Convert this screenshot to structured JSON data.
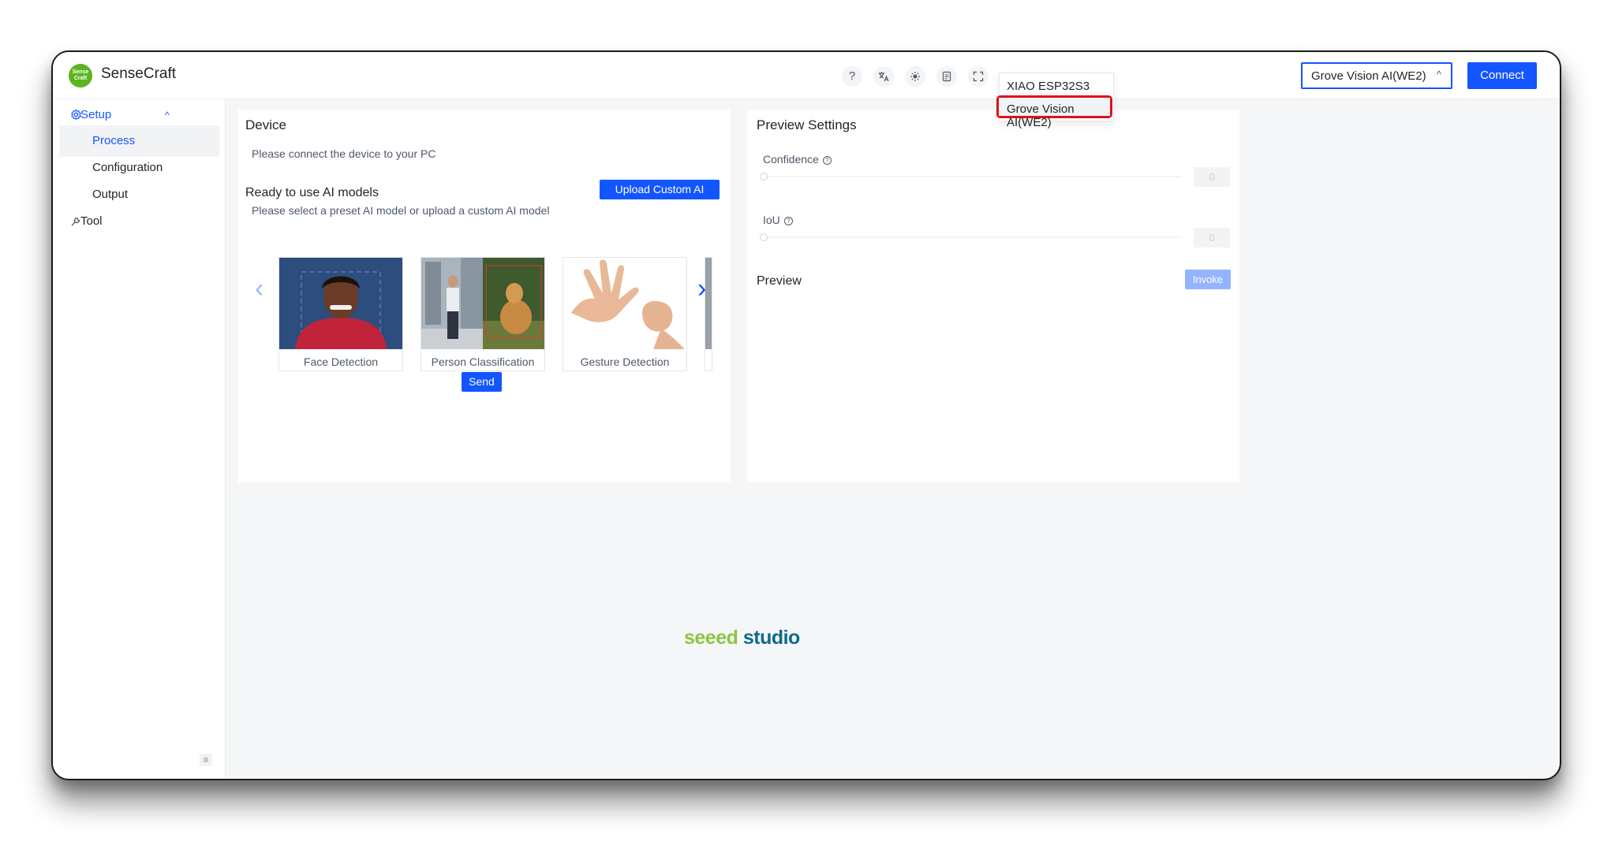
{
  "app": {
    "logo_text": "Sense Craft",
    "title": "SenseCraft"
  },
  "header": {
    "icons": [
      "help-icon",
      "translate-icon",
      "theme-icon",
      "document-icon",
      "fullscreen-icon"
    ],
    "device_select": "Grove Vision AI(WE2)",
    "connect_label": "Connect"
  },
  "dropdown": {
    "options": [
      "XIAO ESP32S3",
      "Grove Vision AI(WE2)"
    ],
    "selected": "Grove Vision AI(WE2)"
  },
  "sidebar": {
    "setup_label": "Setup",
    "items": [
      "Process",
      "Configuration",
      "Output"
    ],
    "active_item": "Process",
    "tool_label": "Tool"
  },
  "device": {
    "title": "Device",
    "message": "Please connect the device to your PC",
    "models_title": "Ready to use AI models",
    "upload_label": "Upload Custom AI Model",
    "models_hint": "Please select a preset AI model or upload a custom AI model",
    "models": [
      "Face Detection",
      "Person Classification",
      "Gesture Detection"
    ],
    "send_label": "Send"
  },
  "preview_settings": {
    "title": "Preview Settings",
    "confidence_label": "Confidence",
    "confidence_value": "0",
    "iou_label": "IoU",
    "iou_value": "0",
    "preview_title": "Preview",
    "invoke_label": "Invoke"
  },
  "footer": {
    "brand_part1": "seeed",
    "brand_part2": " studio"
  },
  "colors": {
    "primary": "#1355ff",
    "highlight": "#e0101b",
    "brand_green": "#8cc63f",
    "brand_blue": "#0b6c8a"
  }
}
